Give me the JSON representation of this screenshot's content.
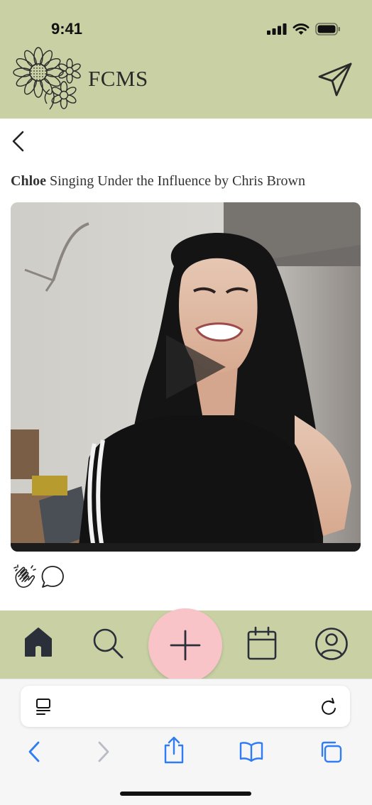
{
  "status_bar": {
    "time": "9:41"
  },
  "header": {
    "brand": "FCMS"
  },
  "post": {
    "author": "Chloe",
    "title": "Singing Under the Influence by Chris Brown"
  },
  "icons": {
    "logo": "sunflower-logo",
    "send": "paper-plane-icon",
    "back": "chevron-left-icon",
    "play": "play-icon",
    "clap": "clapping-hands-icon",
    "comment": "speech-bubble-icon",
    "home": "home-icon",
    "search": "search-icon",
    "add": "plus-icon",
    "calendar": "calendar-icon",
    "profile": "user-circle-icon",
    "reader": "reader-mode-icon",
    "reload": "reload-icon",
    "share": "share-icon",
    "bookmarks": "book-icon",
    "tabs": "tabs-icon"
  },
  "colors": {
    "brand_green": "#c8d0a4",
    "fab_pink": "#f9c4c8",
    "safari_blue": "#2f7cf6",
    "icon_dark": "#2b2f3a"
  }
}
